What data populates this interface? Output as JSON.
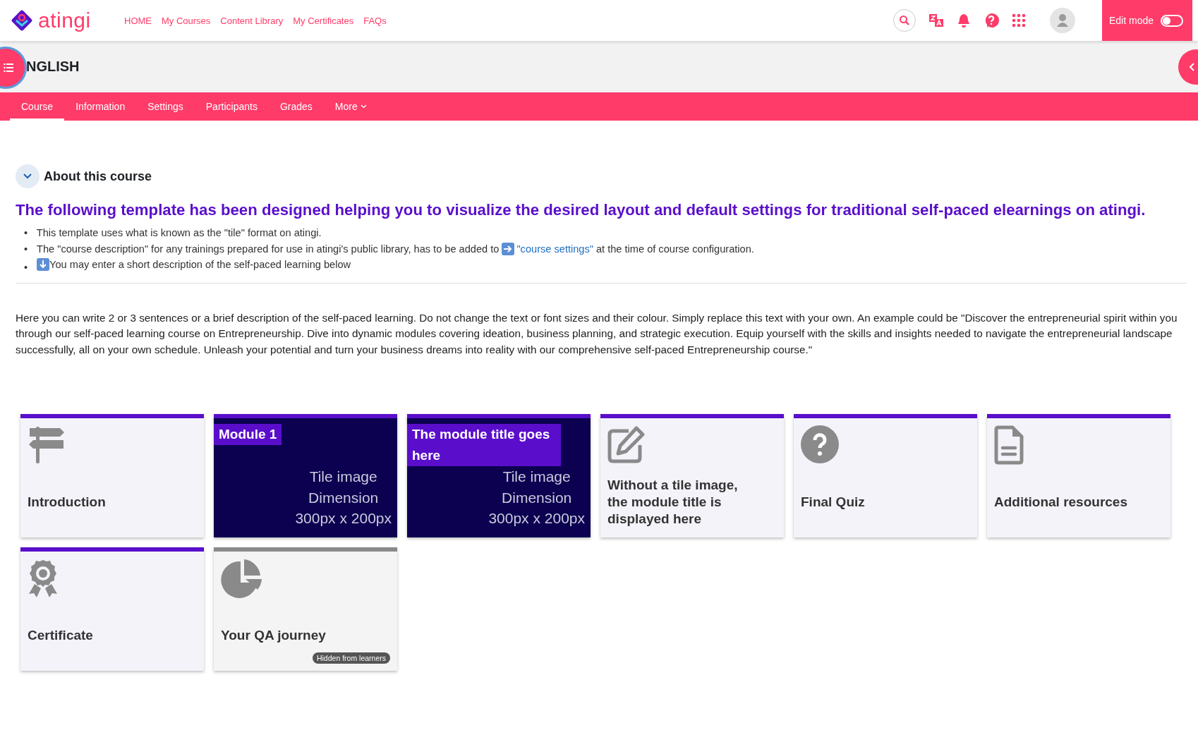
{
  "brand": {
    "name": "atingi"
  },
  "nav": [
    "HOME",
    "My Courses",
    "Content Library",
    "My Certificates",
    "FAQs"
  ],
  "edit_mode": {
    "label": "Edit mode",
    "on": false
  },
  "course": {
    "title": "NGLISH"
  },
  "tabs": [
    {
      "label": "Course",
      "selected": true
    },
    {
      "label": "Information",
      "selected": false
    },
    {
      "label": "Settings",
      "selected": false
    },
    {
      "label": "Participants",
      "selected": false
    },
    {
      "label": "Grades",
      "selected": false
    },
    {
      "label": "More",
      "selected": false,
      "dropdown": true
    }
  ],
  "about": {
    "title": "About this course",
    "expanded": true,
    "heading": "The following template has been designed helping you to visualize the desired layout and default settings for traditional self-paced elearnings on atingi.",
    "bullets": [
      {
        "marker": "•",
        "text": "This template uses what is known as the \"tile\" format on atingi."
      },
      {
        "marker": "•",
        "text": "The \"course description\" for any trainings prepared for use in atingi's public library, has to be added to",
        "link": "\"course settings\"",
        "after": "at the time of course configuration."
      },
      {
        "marker": "•",
        "text": "You may enter a short description of the self-paced learning below",
        "lead_icon": true
      }
    ],
    "description": "Here you can write 2 or 3 sentences or a brief description of the self-paced learning. Do not change the text or font sizes and their colour. Simply replace this text with your own. An example could be \"Discover the entrepreneurial spirit within you through our self-paced learning course on Entrepreneurship. Dive into dynamic modules covering ideation, business planning, and strategic execution. Equip yourself with the skills and insights needed to navigate the entrepreneurial landscape successfully, all on your own schedule. Unleash your potential and turn your business dreams into reality with our comprehensive self-paced Entrepreneurship course.\""
  },
  "tiles": [
    {
      "kind": "icon",
      "title": "Introduction",
      "hidden": false
    },
    {
      "kind": "image",
      "title": "Module 1",
      "image_text": [
        "Tile image",
        "Dimension",
        "300px x 200px"
      ],
      "hidden": false
    },
    {
      "kind": "image",
      "title": "The module title goes here",
      "image_text": [
        "Tile image",
        "Dimension",
        "300px x 200px"
      ],
      "hidden": false
    },
    {
      "kind": "icon",
      "title": "Without a tile image, the module title is displayed here",
      "hidden": false
    },
    {
      "kind": "icon",
      "title": "Final Quiz",
      "hidden": false
    },
    {
      "kind": "icon",
      "title": "Additional resources",
      "hidden": false
    },
    {
      "kind": "icon",
      "title": "Certificate",
      "hidden": false
    },
    {
      "kind": "icon",
      "title": "Your QA journey",
      "hidden": true,
      "badge": "Hidden from learners"
    }
  ]
}
